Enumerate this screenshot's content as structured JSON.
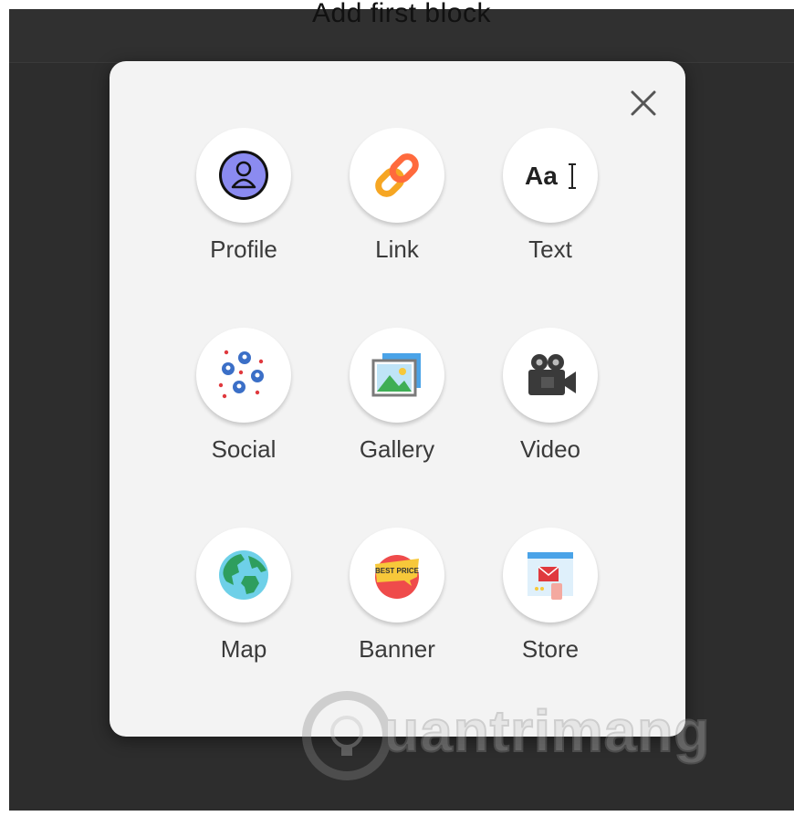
{
  "header": {
    "title": "Add first block"
  },
  "dialog": {
    "close_icon": "close-icon",
    "blocks": [
      {
        "label": "Profile",
        "icon": "profile-icon"
      },
      {
        "label": "Link",
        "icon": "link-icon"
      },
      {
        "label": "Text",
        "icon": "text-icon"
      },
      {
        "label": "Social",
        "icon": "social-icon"
      },
      {
        "label": "Gallery",
        "icon": "gallery-icon"
      },
      {
        "label": "Video",
        "icon": "video-icon"
      },
      {
        "label": "Map",
        "icon": "map-icon"
      },
      {
        "label": "Banner",
        "icon": "banner-icon"
      },
      {
        "label": "Store",
        "icon": "store-icon"
      }
    ],
    "text_icon_glyph": "Aa",
    "banner_icon_text": "BEST PRICE"
  },
  "watermark": {
    "text": "uantrimang"
  },
  "colors": {
    "backdrop": "#2d2d2d",
    "modal": "#f3f3f3",
    "label": "#3a3a3a",
    "profile": "#8b8bf0",
    "link": "#f6a623",
    "social": "#3b6fc7",
    "map_land": "#2e9e5e",
    "map_water": "#6ed0e8",
    "banner_red": "#ef4b4b",
    "banner_yellow": "#f7c83a"
  }
}
